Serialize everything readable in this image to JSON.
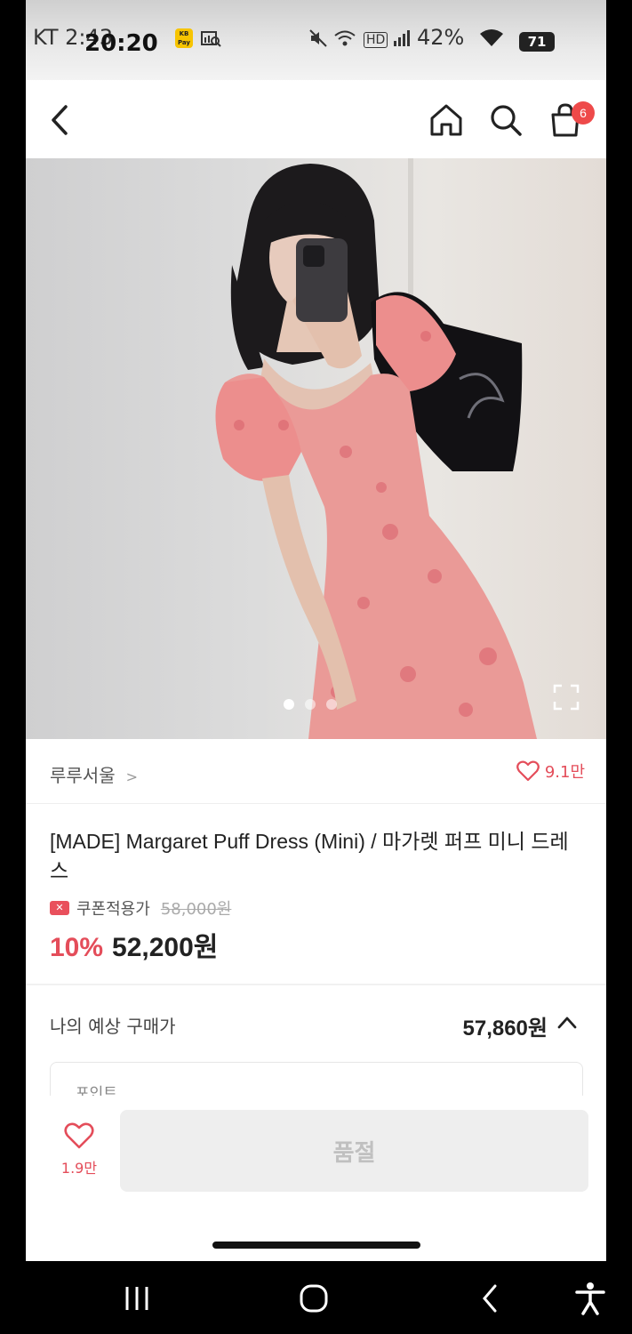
{
  "status_bar": {
    "carrier": "KT 2:43",
    "time": "20:20",
    "pay_label": "KB Pay",
    "battery_pct": "42%",
    "battery_level": "71"
  },
  "header": {
    "cart_count": "6",
    "icons": [
      "back-icon",
      "home-icon",
      "search-icon",
      "cart-icon"
    ]
  },
  "gallery": {
    "image_count": 3,
    "active_index": 0
  },
  "brand": {
    "name": "루루서울",
    "chevron": ">",
    "likes": "9.1만"
  },
  "product": {
    "title": "[MADE] Margaret Puff Dress (Mini) / 마가렛 퍼프 미니 드레스",
    "coupon_label": "쿠폰적용가",
    "original_price": "58,000원",
    "discount": "10%",
    "price": "52,200원"
  },
  "expected_price": {
    "label": "나의 예상 구매가",
    "value": "57,860원"
  },
  "points_box": {
    "label": "포인트"
  },
  "action_bar": {
    "wish_count": "1.9만",
    "sold_out_label": "품절"
  },
  "colors": {
    "accent": "#e44d5a",
    "badge": "#ee4a4a"
  }
}
